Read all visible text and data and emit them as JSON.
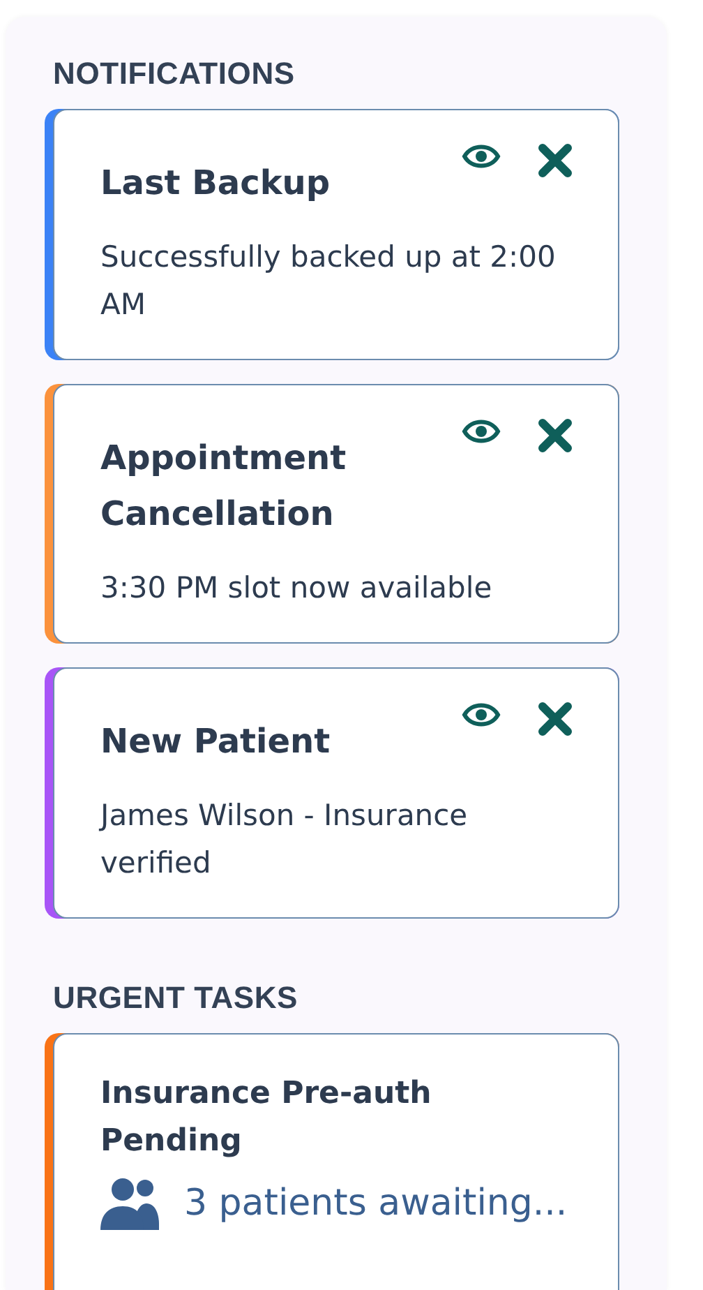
{
  "sections": [
    {
      "kind": "notifications",
      "heading": "NOTIFICATIONS",
      "items": [
        {
          "title": "Last Backup",
          "message": "Successfully backed up at 2:00 AM",
          "color": "#3b82f6"
        },
        {
          "title": "Appointment Cancellation",
          "message": "3:30 PM slot now available",
          "color": "#fb923c"
        },
        {
          "title": "New Patient",
          "message": "James Wilson - Insurance verified",
          "color": "#a855f7"
        }
      ]
    },
    {
      "kind": "tasks",
      "heading": "URGENT TASKS",
      "items": [
        {
          "title": "Insurance Pre-auth Pending",
          "detail": "3 patients awaiting...",
          "color": "#f97316"
        }
      ]
    }
  ]
}
